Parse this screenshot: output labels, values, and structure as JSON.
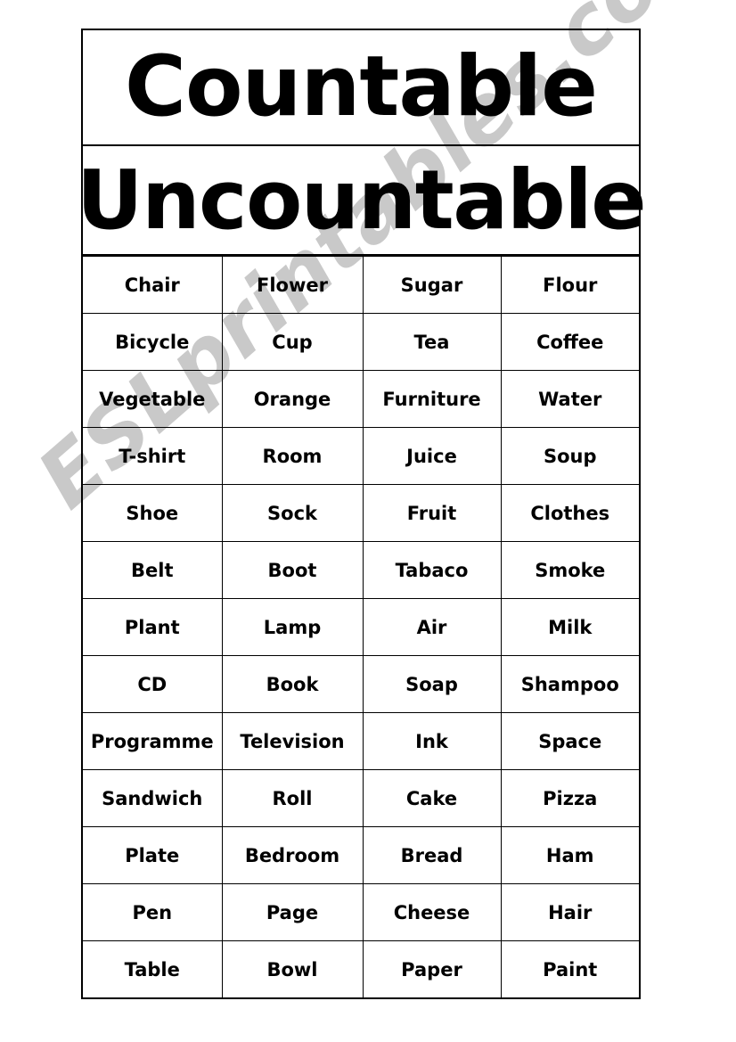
{
  "worksheet": {
    "headings": {
      "countable": "Countable",
      "uncountable": "Uncountable"
    },
    "colors": {
      "text": "#000000",
      "border": "#000000",
      "background": "#ffffff",
      "watermark": "#c9c9c9"
    },
    "watermark": "ESLprintables.com",
    "columns": 4,
    "rows": [
      [
        "Chair",
        "Flower",
        "Sugar",
        "Flour"
      ],
      [
        "Bicycle",
        "Cup",
        "Tea",
        "Coffee"
      ],
      [
        "Vegetable",
        "Orange",
        "Furniture",
        "Water"
      ],
      [
        "T-shirt",
        "Room",
        "Juice",
        "Soup"
      ],
      [
        "Shoe",
        "Sock",
        "Fruit",
        "Clothes"
      ],
      [
        "Belt",
        "Boot",
        "Tabaco",
        "Smoke"
      ],
      [
        "Plant",
        "Lamp",
        "Air",
        "Milk"
      ],
      [
        "CD",
        "Book",
        "Soap",
        "Shampoo"
      ],
      [
        "Programme",
        "Television",
        "Ink",
        "Space"
      ],
      [
        "Sandwich",
        "Roll",
        "Cake",
        "Pizza"
      ],
      [
        "Plate",
        "Bedroom",
        "Bread",
        "Ham"
      ],
      [
        "Pen",
        "Page",
        "Cheese",
        "Hair"
      ],
      [
        "Table",
        "Bowl",
        "Paper",
        "Paint"
      ]
    ]
  }
}
